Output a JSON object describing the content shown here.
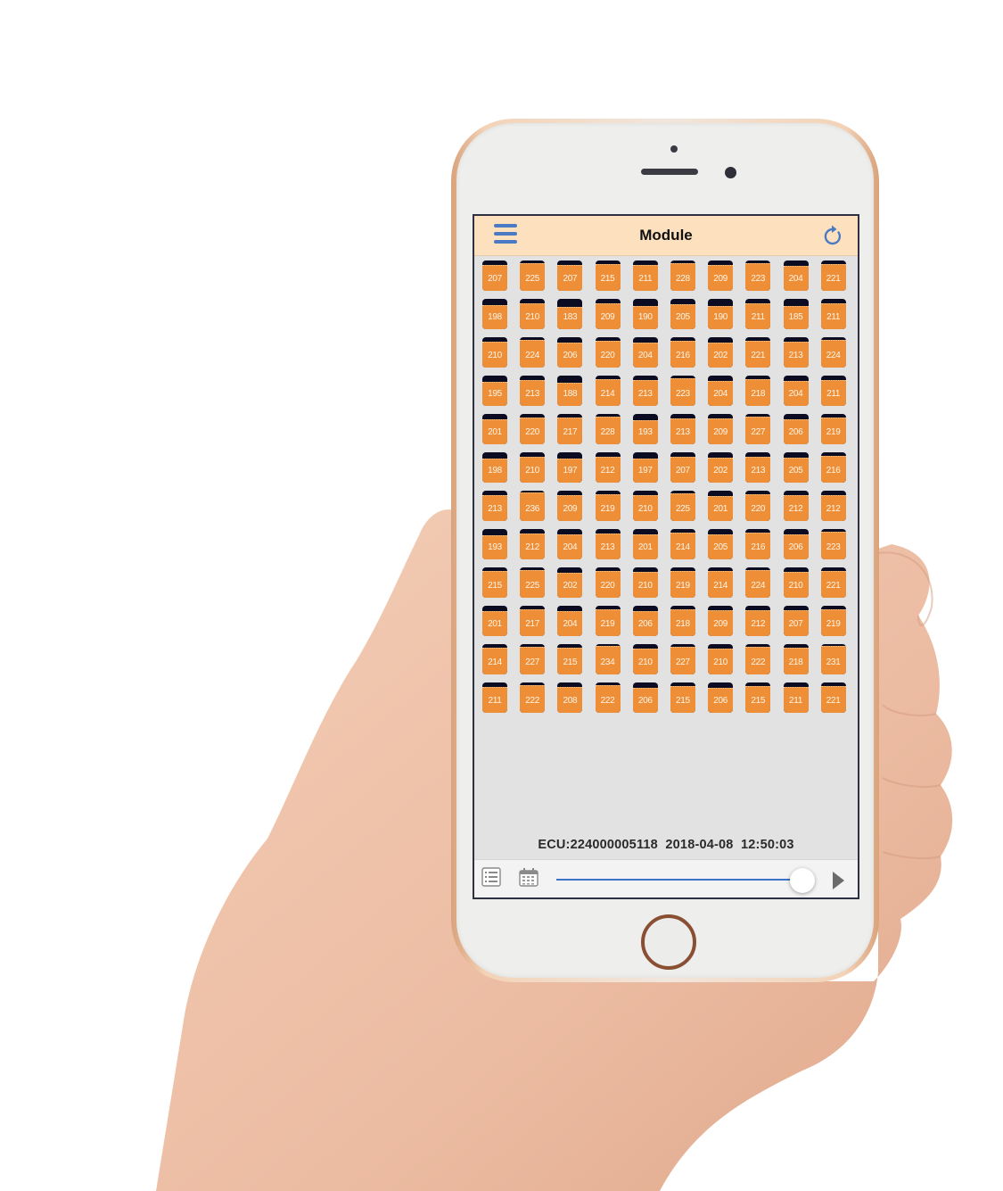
{
  "app": {
    "title": "Module",
    "icons": {
      "menu": "hamburger-menu-icon",
      "refresh": "refresh-icon",
      "list": "list-icon",
      "calendar": "calendar-icon",
      "play": "play-icon"
    }
  },
  "colors": {
    "navbar_bg": "#fde0bd",
    "module_fill": "#ee8f38",
    "module_empty": "#0b0b22",
    "accent": "#4a7ac4",
    "screen_bg": "#e2e2e2"
  },
  "modules": {
    "scale_max": 240,
    "rows": [
      [
        207,
        225,
        207,
        215,
        211,
        228,
        209,
        223,
        204,
        221
      ],
      [
        198,
        210,
        183,
        209,
        190,
        205,
        190,
        211,
        185,
        211
      ],
      [
        210,
        224,
        206,
        220,
        204,
        216,
        202,
        221,
        213,
        224
      ],
      [
        195,
        213,
        188,
        214,
        213,
        223,
        204,
        218,
        204,
        211
      ],
      [
        201,
        220,
        217,
        228,
        193,
        213,
        209,
        227,
        206,
        219
      ],
      [
        198,
        210,
        197,
        212,
        197,
        207,
        202,
        213,
        205,
        216
      ],
      [
        213,
        236,
        209,
        219,
        210,
        225,
        201,
        220,
        212,
        212
      ],
      [
        193,
        212,
        204,
        213,
        201,
        214,
        205,
        216,
        206,
        223
      ],
      [
        215,
        225,
        202,
        220,
        210,
        219,
        214,
        224,
        210,
        221
      ],
      [
        201,
        217,
        204,
        219,
        206,
        218,
        209,
        212,
        207,
        219
      ],
      [
        214,
        227,
        215,
        234,
        210,
        227,
        210,
        222,
        218,
        231
      ],
      [
        211,
        222,
        208,
        222,
        206,
        215,
        206,
        215,
        211,
        221
      ]
    ]
  },
  "status": {
    "text": "ECU:224000005118  2018-04-08  12:50:03",
    "ecu": "224000005118",
    "date": "2018-04-08",
    "time": "12:50:03"
  },
  "playback": {
    "slider_position": 0.95
  }
}
